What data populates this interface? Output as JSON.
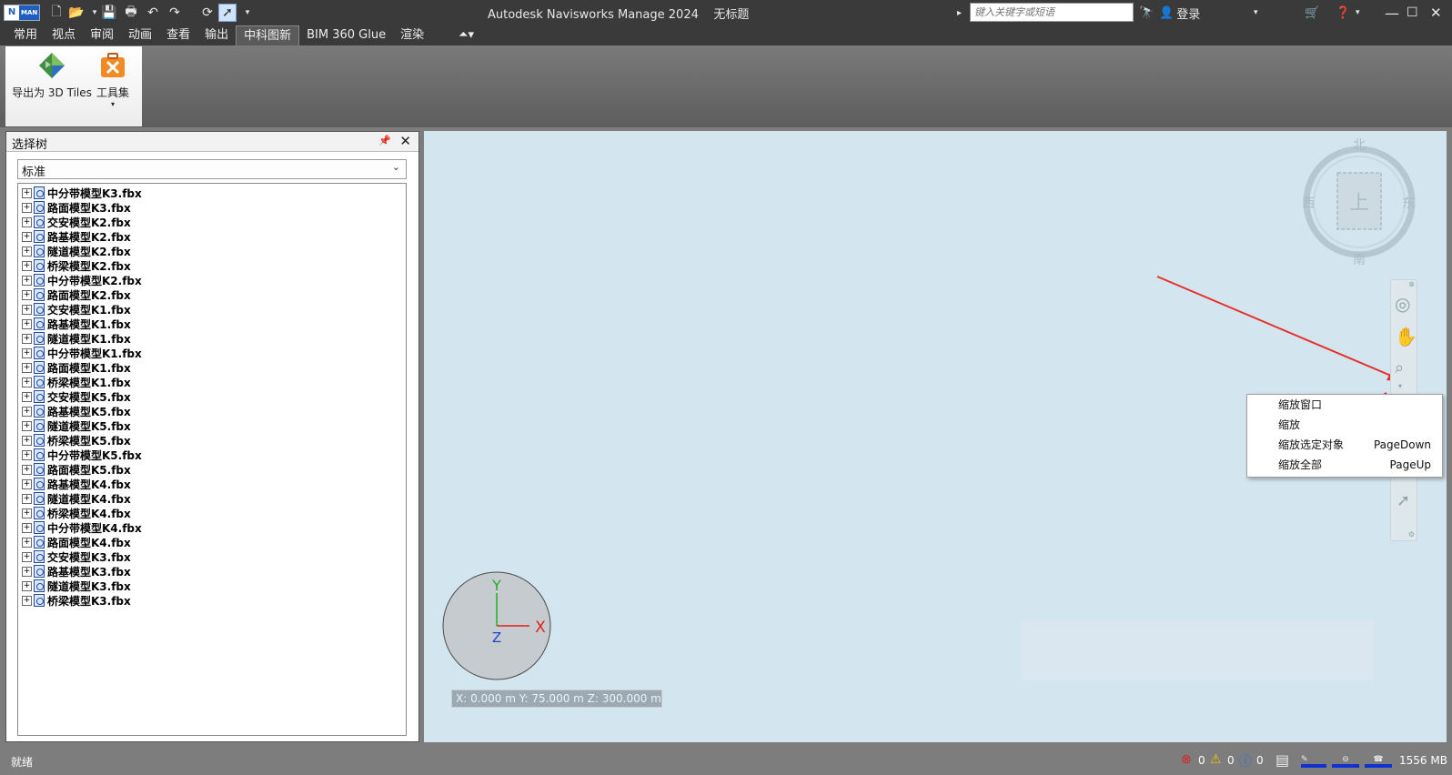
{
  "app": {
    "title": "Autodesk Navisworks Manage 2024",
    "doc_title": "无标题",
    "logo_n": "N",
    "logo_man": "MAN"
  },
  "search": {
    "placeholder": "键入关键字或短语"
  },
  "account": {
    "login_label": "登录"
  },
  "tabs": [
    {
      "label": "常用"
    },
    {
      "label": "视点"
    },
    {
      "label": "审阅"
    },
    {
      "label": "动画"
    },
    {
      "label": "查看"
    },
    {
      "label": "输出"
    },
    {
      "label": "中科图新",
      "active": true
    },
    {
      "label": "BIM 360 Glue"
    },
    {
      "label": "渲染"
    }
  ],
  "ribbon": {
    "export_label": "导出为 3D Tiles",
    "toolset_label": "工具集"
  },
  "selection_tree": {
    "title": "选择树",
    "mode": "标准",
    "items": [
      "中分带模型K3.fbx",
      "路面模型K3.fbx",
      "交安模型K2.fbx",
      "路基模型K2.fbx",
      "隧道模型K2.fbx",
      "桥梁模型K2.fbx",
      "中分带模型K2.fbx",
      "路面模型K2.fbx",
      "交安模型K1.fbx",
      "路基模型K1.fbx",
      "隧道模型K1.fbx",
      "中分带模型K1.fbx",
      "路面模型K1.fbx",
      "桥梁模型K1.fbx",
      "交安模型K5.fbx",
      "路基模型K5.fbx",
      "隧道模型K5.fbx",
      "桥梁模型K5.fbx",
      "中分带模型K5.fbx",
      "路面模型K5.fbx",
      "路基模型K4.fbx",
      "隧道模型K4.fbx",
      "桥梁模型K4.fbx",
      "中分带模型K4.fbx",
      "路面模型K4.fbx",
      "交安模型K3.fbx",
      "路基模型K3.fbx",
      "隧道模型K3.fbx",
      "桥梁模型K3.fbx"
    ]
  },
  "viewcube": {
    "north": "北",
    "south": "南",
    "east": "东",
    "west": "西",
    "face": "上"
  },
  "axes": {
    "x": "X",
    "y": "Y",
    "z": "Z"
  },
  "coords": {
    "text": "X: 0.000 m  Y: 75.000 m  Z: 300.000 m"
  },
  "context_menu": [
    {
      "label": "缩放窗口",
      "shortcut": ""
    },
    {
      "label": "缩放",
      "shortcut": ""
    },
    {
      "label": "缩放选定对象",
      "shortcut": "PageDown"
    },
    {
      "label": "缩放全部",
      "shortcut": "PageUp"
    }
  ],
  "status": {
    "ready": "就绪",
    "errors": "0",
    "warnings": "0",
    "info": "0",
    "memory": "1556 MB"
  },
  "colors": {
    "title_bar": "#3a3a3a",
    "viewport_bg": "#d3e5ef",
    "arrow_red": "#e8302a",
    "axis_x": "#e02020",
    "axis_y": "#20b020",
    "axis_z": "#2040d0"
  }
}
